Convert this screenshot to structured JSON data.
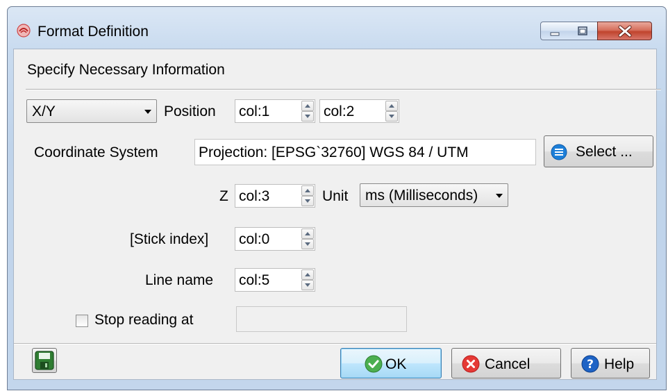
{
  "window": {
    "title": "Format Definition",
    "accent_color": "#c9dbef"
  },
  "heading": "Specify Necessary Information",
  "position_row": {
    "type_select": "X/Y",
    "position_label": "Position",
    "x_col": "col:1",
    "y_col": "col:2"
  },
  "coordinate_system": {
    "label": "Coordinate System",
    "value": "Projection: [EPSG`32760] WGS 84 / UTM",
    "select_button": "Select ..."
  },
  "z_row": {
    "label": "Z",
    "col": "col:3",
    "unit_label": "Unit",
    "unit_select": "ms (Milliseconds)"
  },
  "stick_index": {
    "label": "[Stick index]",
    "col": "col:0"
  },
  "line_name": {
    "label": "Line name",
    "col": "col:5"
  },
  "stop_reading": {
    "label": "Stop reading at",
    "checked": false,
    "value": ""
  },
  "footer": {
    "save_icon": "save-icon",
    "ok_label": "OK",
    "cancel_label": "Cancel",
    "help_label": "Help"
  }
}
